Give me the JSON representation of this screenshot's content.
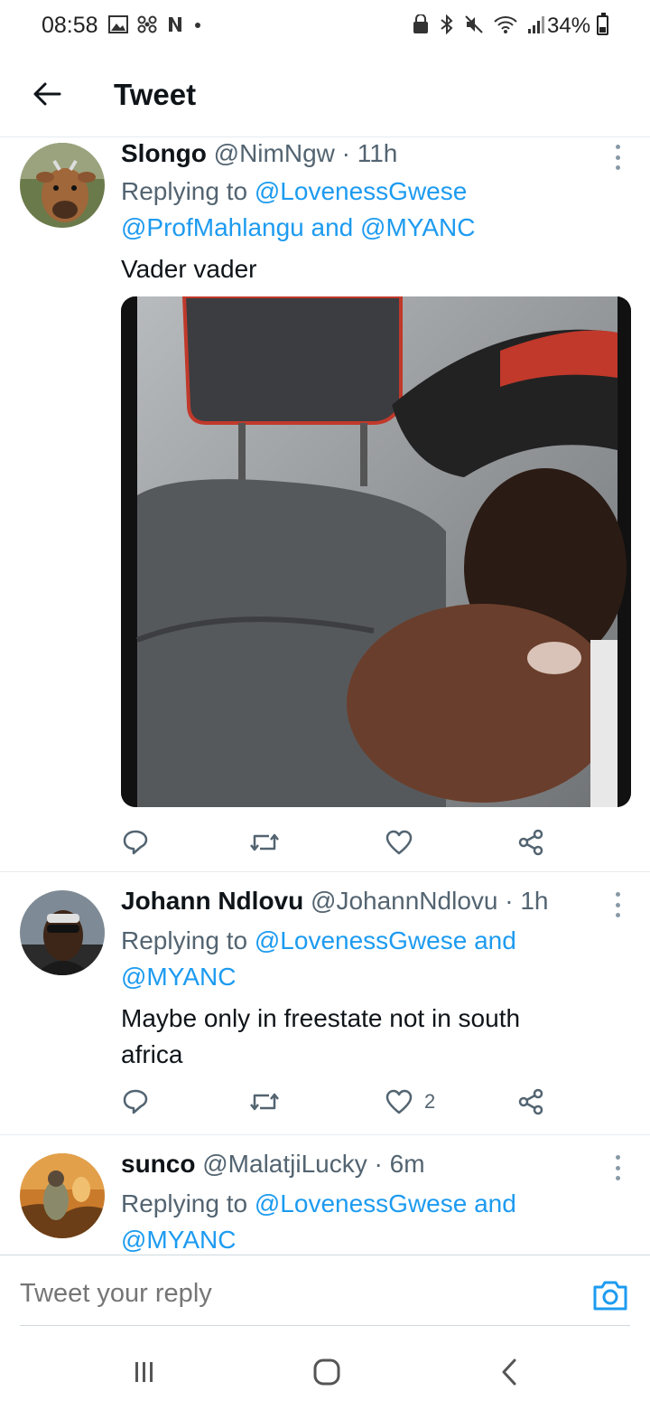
{
  "status_bar": {
    "time": "08:58",
    "battery": "34%",
    "battery_level": 0.34
  },
  "header": {
    "title": "Tweet",
    "back_icon": "arrow-left-icon"
  },
  "tweets": [
    {
      "name": "Slongo",
      "handle": "@NimNgw",
      "time": "· 11h",
      "reply_prefix": "Replying to ",
      "mentions_line1": "@LovenessGwese",
      "mentions_line2": "@ProfMahlangu and @MYANC",
      "text": "Vader vader",
      "likes": ""
    },
    {
      "name": "Johann Ndlovu",
      "handle": "@JohannNdlovu",
      "time": "· 1h",
      "reply_prefix": "Replying to ",
      "mentions_line1": "@LovenessGwese and",
      "mentions_line2": "@MYANC",
      "text_line1": "Maybe only in freestate not in south",
      "text_line2": "africa",
      "likes": "2"
    },
    {
      "name": "sunco",
      "handle": "@MalatjiLucky",
      "time": "· 6m",
      "reply_prefix": "Replying to ",
      "mentions_line1": "@LovenessGwese and",
      "mentions_line2": "@MYANC"
    }
  ],
  "reply_bar": {
    "placeholder": "Tweet your reply",
    "camera_icon": "camera-icon"
  },
  "colors": {
    "accent": "#1d9bf0",
    "secondary_text": "#536471",
    "primary_text": "#0f1419"
  }
}
